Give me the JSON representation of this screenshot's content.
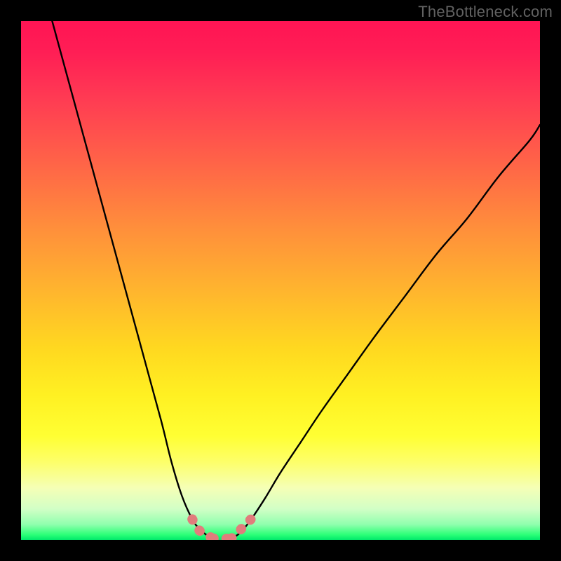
{
  "watermark": "TheBottleneck.com",
  "chart_data": {
    "type": "line",
    "title": "",
    "xlabel": "",
    "ylabel": "",
    "xlim": [
      0,
      100
    ],
    "ylim": [
      0,
      100
    ],
    "series": [
      {
        "name": "curve-left",
        "x": [
          6,
          9,
          12,
          15,
          18,
          21,
          24,
          27,
          29,
          31,
          33,
          34.5,
          36,
          37
        ],
        "y": [
          100,
          89,
          78,
          67,
          56,
          45,
          34,
          23,
          15,
          8.5,
          4,
          2,
          0.8,
          0.3
        ]
      },
      {
        "name": "curve-right",
        "x": [
          40.5,
          42,
          44,
          47,
          50,
          54,
          58,
          63,
          68,
          74,
          80,
          86,
          92,
          98,
          100
        ],
        "y": [
          0.3,
          1.2,
          3.5,
          8,
          13,
          19,
          25,
          32,
          39,
          47,
          55,
          62,
          70,
          77,
          80
        ]
      },
      {
        "name": "highlight-left",
        "x": [
          33,
          34,
          35,
          36,
          37
        ],
        "y": [
          4,
          2.2,
          1.2,
          0.8,
          0.3
        ]
      },
      {
        "name": "highlight-bottom",
        "x": [
          37,
          38.8,
          40.5
        ],
        "y": [
          0.3,
          0.2,
          0.3
        ]
      },
      {
        "name": "highlight-right",
        "x": [
          40.5,
          41.5,
          42.5,
          43.5,
          44.5
        ],
        "y": [
          0.3,
          1.0,
          2.2,
          3.2,
          4.2
        ]
      }
    ],
    "annotations": []
  }
}
